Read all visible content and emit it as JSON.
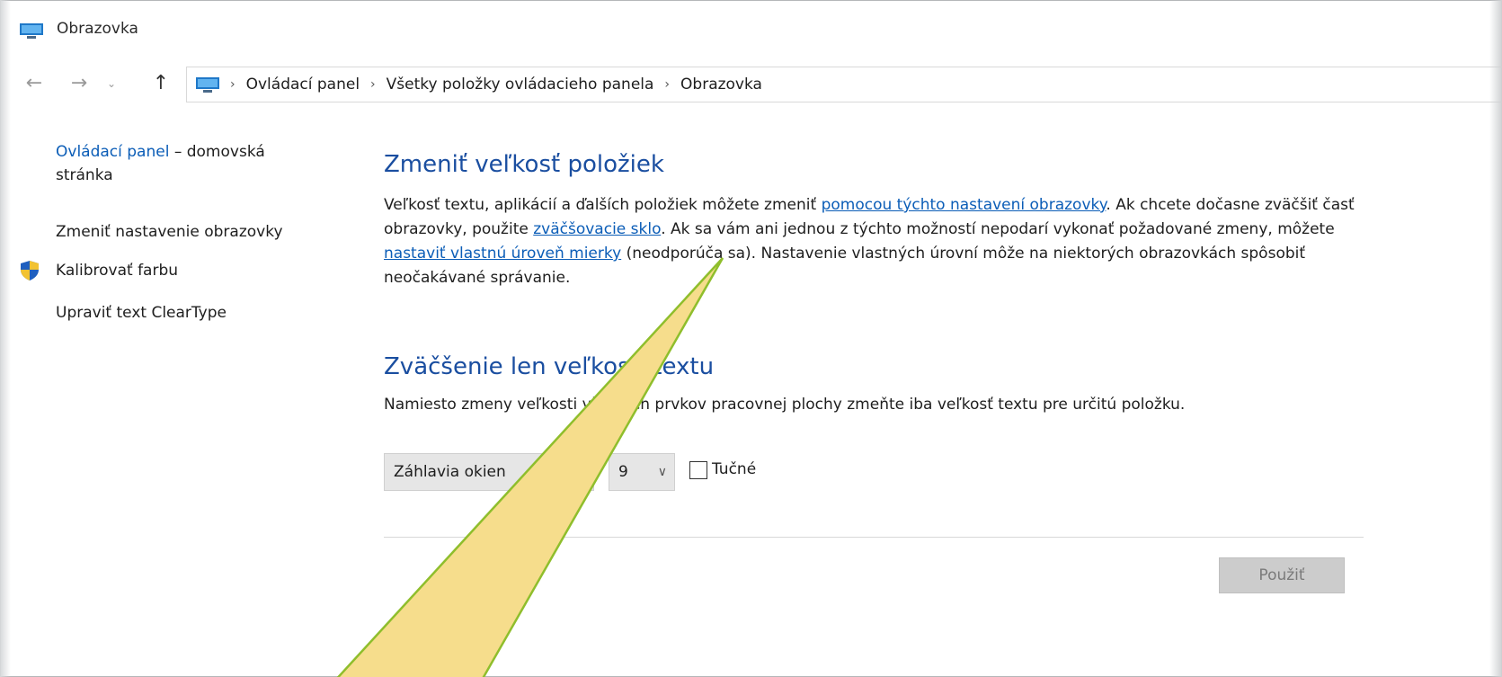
{
  "window": {
    "title": "Obrazovka",
    "icon": "monitor-icon"
  },
  "nav": {
    "back": "←",
    "forward": "→",
    "recent": "⌄",
    "up": "↑",
    "breadcrumb": [
      "Ovládací panel",
      "Všetky položky ovládacieho panela",
      "Obrazovka"
    ],
    "separator": "›"
  },
  "sidebar": {
    "home_link": "Ovládací panel",
    "home_rest": " – domovská stránka",
    "items": [
      {
        "label": "Zmeniť nastavenie obrazovky"
      },
      {
        "label": "Kalibrovať farbu",
        "icon": "uac-shield-icon"
      },
      {
        "label": "Upraviť text ClearType"
      }
    ]
  },
  "section1": {
    "heading": "Zmeniť veľkosť položiek",
    "p1": "Veľkosť textu, aplikácií a ďalších položiek môžete zmeniť ",
    "link1": "pomocou týchto nastavení obrazovky",
    "p2": ". Ak chcete dočasne zväčšiť časť obrazovky, použite ",
    "link2": "zväčšovacie sklo",
    "p3": ". Ak sa vám ani jednou z týchto možností nepodarí vykonať požadované zmeny, môžete ",
    "link3": "nastaviť vlastnú úroveň mierky",
    "p4": " (neodporúča sa). Nastavenie vlastných úrovní môže na niektorých obrazovkách spôsobiť neočakávané správanie."
  },
  "section2": {
    "heading": "Zväčšenie len veľkosti textu",
    "description": "Namiesto zmeny veľkosti všetkých prvkov pracovnej plochy zmeňte iba veľkosť textu pre určitú položku.",
    "item_select_value": "Záhlavia okien",
    "size_select_value": "9",
    "bold_label": "Tučné",
    "bold_checked": false
  },
  "apply_button": "Použiť",
  "colors": {
    "heading": "#1a4ea0",
    "link": "#0b5db7",
    "callout_fill": "#f6dd8c",
    "callout_stroke": "#8fbe2c"
  }
}
